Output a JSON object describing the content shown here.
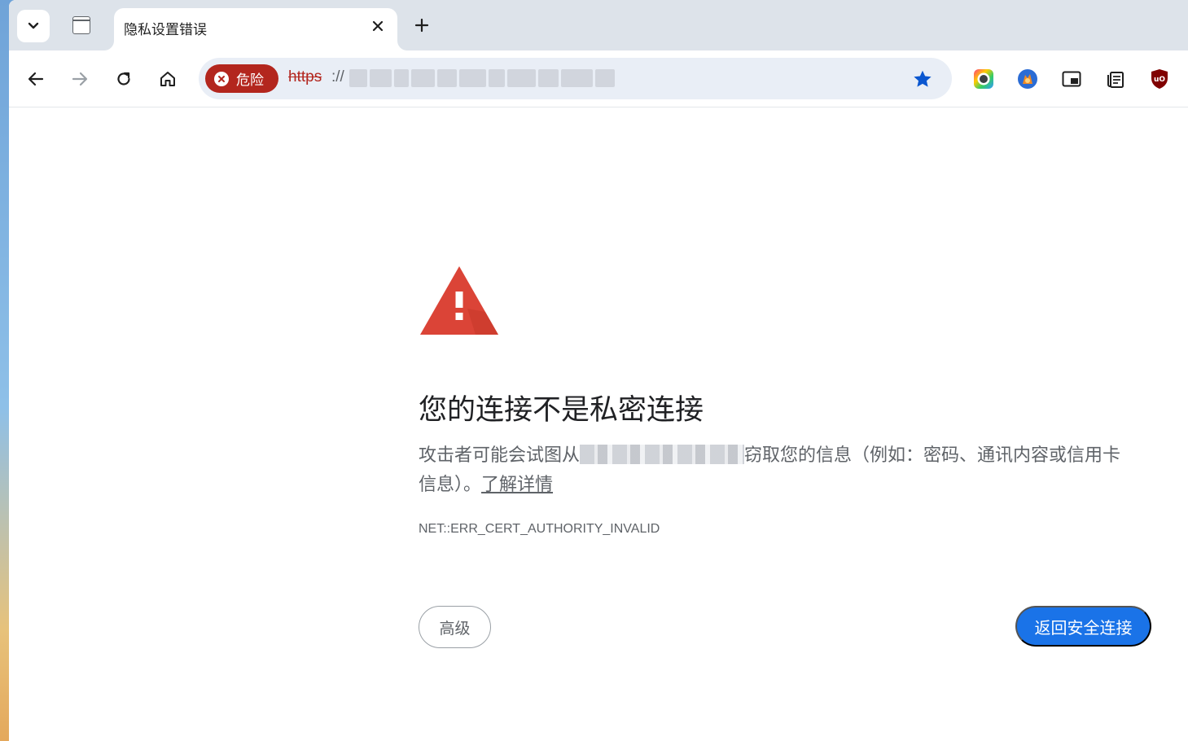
{
  "tabs": {
    "active_title": "隐私设置错误"
  },
  "omnibox": {
    "security_chip_label": "危险",
    "url_scheme": "https",
    "url_separator": "://"
  },
  "extensions": [
    "color-picker-extension-icon",
    "profile-fox-extension-icon",
    "picture-in-picture-extension-icon",
    "reading-list-extension-icon",
    "ublock-origin-extension-icon"
  ],
  "interstitial": {
    "heading": "您的连接不是私密连接",
    "message_before": "攻击者可能会试图从",
    "message_after": "窃取您的信息（例如：密码、通讯内容或信用卡信息）。",
    "learn_more": "了解详情",
    "error_code": "NET::ERR_CERT_AUTHORITY_INVALID",
    "advanced_button": "高级",
    "back_button": "返回安全连接"
  },
  "colors": {
    "danger": "#b3261e",
    "primary": "#1a73e8",
    "warning_triangle": "#db4437"
  }
}
